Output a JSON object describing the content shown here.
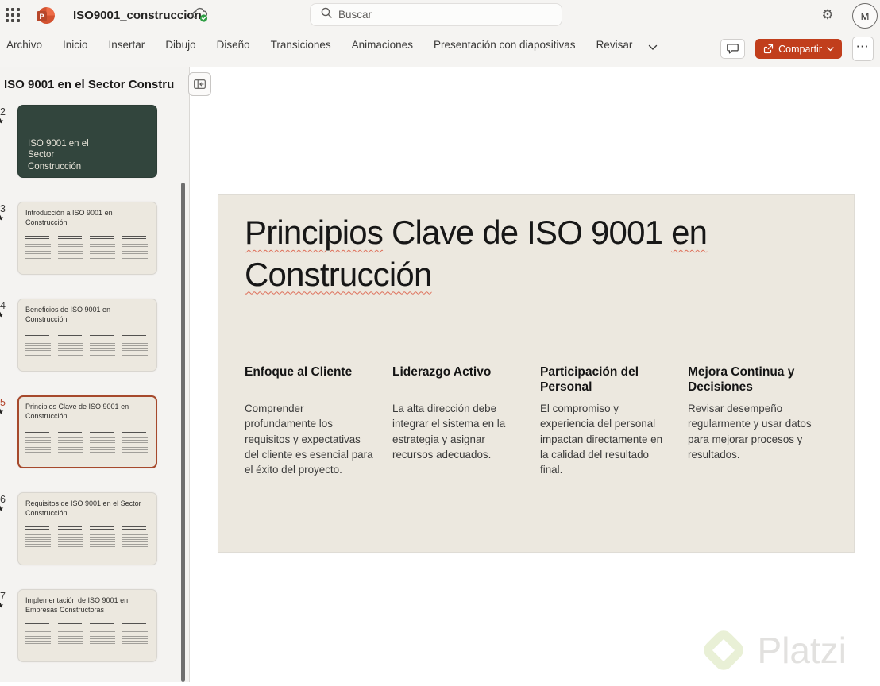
{
  "chrome": {
    "document_title": "ISO9001_construccion",
    "search_placeholder": "Buscar",
    "avatar_initial": "M",
    "menu_tabs": [
      "Archivo",
      "Inicio",
      "Insertar",
      "Dibujo",
      "Diseño",
      "Transiciones",
      "Animaciones",
      "Presentación con diapositivas",
      "Revisar"
    ],
    "share_label": "Compartir",
    "more_label": "···"
  },
  "panel": {
    "heading": "ISO 9001 en el Sector Constru",
    "slides": [
      {
        "number": "2",
        "title": "ISO 9001 en el Sector Construcción",
        "variant": "dark",
        "selected": false
      },
      {
        "number": "3",
        "title": "Introducción a ISO 9001 en Construcción",
        "variant": "light",
        "selected": false
      },
      {
        "number": "4",
        "title": "Beneficios de ISO 9001 en Construcción",
        "variant": "light",
        "selected": false
      },
      {
        "number": "5",
        "title": "Principios Clave de ISO 9001 en Construcción",
        "variant": "light",
        "selected": true
      },
      {
        "number": "6",
        "title": "Requisitos de ISO 9001 en el Sector Construcción",
        "variant": "light",
        "selected": false
      },
      {
        "number": "7",
        "title": "Implementación de ISO 9001 en Empresas Constructoras",
        "variant": "light",
        "selected": false
      }
    ]
  },
  "slide": {
    "title_segments": [
      {
        "text": "Principios",
        "misspelled": true
      },
      {
        "text": " Clave de ISO 9001 ",
        "misspelled": false
      },
      {
        "text": "en",
        "misspelled": true
      },
      {
        "text": " ",
        "misspelled": false
      },
      {
        "text": "Construcción",
        "misspelled": true
      }
    ],
    "columns": [
      {
        "heading": "Enfoque al Cliente",
        "body": "Comprender profundamente los requisitos y expectativas del cliente es esencial para el éxito del proyecto."
      },
      {
        "heading": "Liderazgo Activo",
        "body": "La alta dirección debe integrar el sistema en la estrategia y asignar recursos adecuados."
      },
      {
        "heading": "Participación del Personal",
        "body": "El compromiso y experiencia del personal impactan directamente en la calidad del resultado final."
      },
      {
        "heading": "Mejora Continua y Decisiones",
        "body": "Revisar desempeño regularmente y usar datos para mejorar procesos y resultados."
      }
    ],
    "watermark_text": "Platzi"
  },
  "colors": {
    "share_button": "#C13E1C",
    "selected_outline": "#A6492C",
    "slide_dark_green": "#32453D",
    "slide_cream": "#ECE8DF",
    "saved_check_green": "#2E9E44",
    "watermark_green": "#E9F0D6",
    "squiggle_red": "#DE705A"
  }
}
